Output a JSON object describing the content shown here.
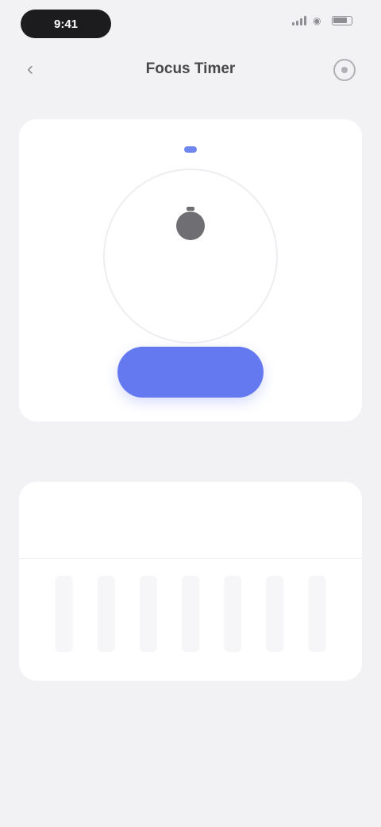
{
  "status": {
    "time": "9:41"
  },
  "nav": {
    "title": "Focus Timer"
  },
  "timer": {
    "subtitle": "",
    "readout": "",
    "reset_label": "",
    "start_label": "",
    "skip_label": ""
  },
  "stats": {
    "heading": "",
    "title": "",
    "subtitle": "",
    "total": "",
    "note": ""
  },
  "colors": {
    "accent": "#6478f0",
    "background": "#f2f2f4",
    "card": "#ffffff"
  },
  "icons": [
    "back-icon",
    "settings-icon",
    "timer-icon",
    "signal-icon",
    "wifi-icon",
    "battery-icon"
  ],
  "chart_data": {
    "type": "bar",
    "categories": [
      "",
      "",
      "",
      "",
      "",
      "",
      ""
    ],
    "values": [
      0,
      0,
      0,
      0,
      0,
      0,
      0
    ]
  }
}
